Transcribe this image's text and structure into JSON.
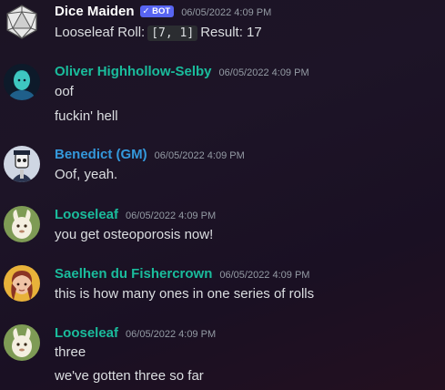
{
  "messages": [
    {
      "author": "Dice Maiden",
      "author_color": "#ffffff",
      "badge": "✓ BOT",
      "timestamp": "06/05/2022 4:09 PM",
      "avatar": "d20-icon",
      "roll_prefix": "Looseleaf Roll:",
      "roll_code": "[7, 1]",
      "roll_result": "Result: 17"
    },
    {
      "author": "Oliver Highhollow-Selby",
      "author_color": "#1abc9c",
      "timestamp": "06/05/2022 4:09 PM",
      "avatar": "oliver-avatar",
      "lines": [
        "oof",
        "fuckin' hell"
      ]
    },
    {
      "author": "Benedict (GM)",
      "author_color": "#3498db",
      "timestamp": "06/05/2022 4:09 PM",
      "avatar": "benedict-avatar",
      "lines": [
        "Oof, yeah."
      ]
    },
    {
      "author": "Looseleaf",
      "author_color": "#1abc9c",
      "timestamp": "06/05/2022 4:09 PM",
      "avatar": "looseleaf-avatar",
      "lines": [
        "you get osteoporosis now!"
      ]
    },
    {
      "author": "Saelhen du Fishercrown",
      "author_color": "#1abc9c",
      "timestamp": "06/05/2022 4:09 PM",
      "avatar": "saelhen-avatar",
      "lines": [
        "this is how many ones in one series of rolls"
      ]
    },
    {
      "author": "Looseleaf",
      "author_color": "#1abc9c",
      "timestamp": "06/05/2022 4:09 PM",
      "avatar": "looseleaf-avatar",
      "lines": [
        "three",
        "we've gotten three so far"
      ]
    }
  ]
}
